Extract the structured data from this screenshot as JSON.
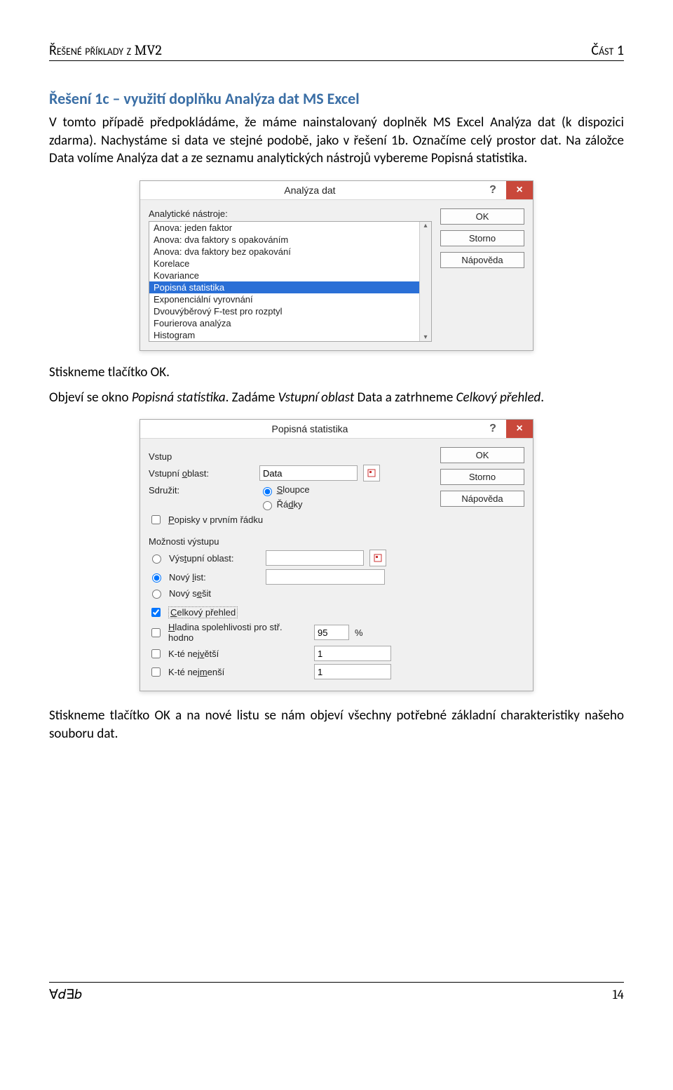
{
  "header": {
    "left_prefix": "Řešené příklady z ",
    "left_mv2": "MV2",
    "right": "Část 1"
  },
  "section": {
    "title": "Řešení 1c – využití doplňku Analýza dat MS Excel",
    "p1": "V tomto případě předpokládáme, že máme nainstalovaný doplněk MS Excel Analýza dat (k dispozici zdarma). Nachystáme si data ve stejné podobě, jako v řešení 1b. Označíme celý prostor dat. Na záložce Data volíme Analýza dat a ze seznamu analytických nástrojů vybereme Popisná statistika.",
    "p2a": "Stiskneme tlačítko OK.",
    "p2b_pre": "Objeví se okno ",
    "p2b_i1": "Popisná statistika",
    "p2b_mid": ". Zadáme ",
    "p2b_i2": "Vstupní oblast",
    "p2b_mid2": " Data a zatrhneme ",
    "p2b_i3": "Celkový přehled",
    "p2b_end": ".",
    "p3": "Stiskneme tlačítko OK a na nové listu se nám objeví všechny potřebné základní charakteristiky našeho souboru dat."
  },
  "dialog1": {
    "title": "Analýza dat",
    "help": "?",
    "close": "×",
    "tools_label": "Analytické nástroje:",
    "items": [
      "Anova: jeden faktor",
      "Anova: dva faktory s opakováním",
      "Anova: dva faktory bez opakování",
      "Korelace",
      "Kovariance",
      "Popisná statistika",
      "Exponenciální vyrovnání",
      "Dvouvýběrový F-test pro rozptyl",
      "Fourierova analýza",
      "Histogram"
    ],
    "selected_index": 5,
    "ok": "OK",
    "cancel": "Storno",
    "help_btn": "Nápověda"
  },
  "dialog2": {
    "title": "Popisná statistika",
    "help": "?",
    "close": "×",
    "ok": "OK",
    "cancel": "Storno",
    "help_btn": "Nápověda",
    "vstup_label": "Vstup",
    "vstupni_oblast": "Vstupní oblast:",
    "vstupni_value": "Data",
    "sdruzit": "Sdružit:",
    "sloupce": "Sloupce",
    "radky": "Řádky",
    "popisky": "Popisky v prvním řádku",
    "moznosti_label": "Možnosti výstupu",
    "vystupni_oblast": "Výstupní oblast:",
    "novy_list": "Nový list:",
    "novy_sesit": "Nový sešit",
    "celkovy_prehled": "Celkový přehled",
    "hladina": "Hladina spolehlivosti pro stř. hodno",
    "hladina_val": "95",
    "percent": "%",
    "knejvetsi": "K-té největší",
    "knejmensi": "K-té nejmenší",
    "k_val": "1"
  },
  "footer": {
    "left": "∀𝑑∃𝑏",
    "right": "14"
  }
}
